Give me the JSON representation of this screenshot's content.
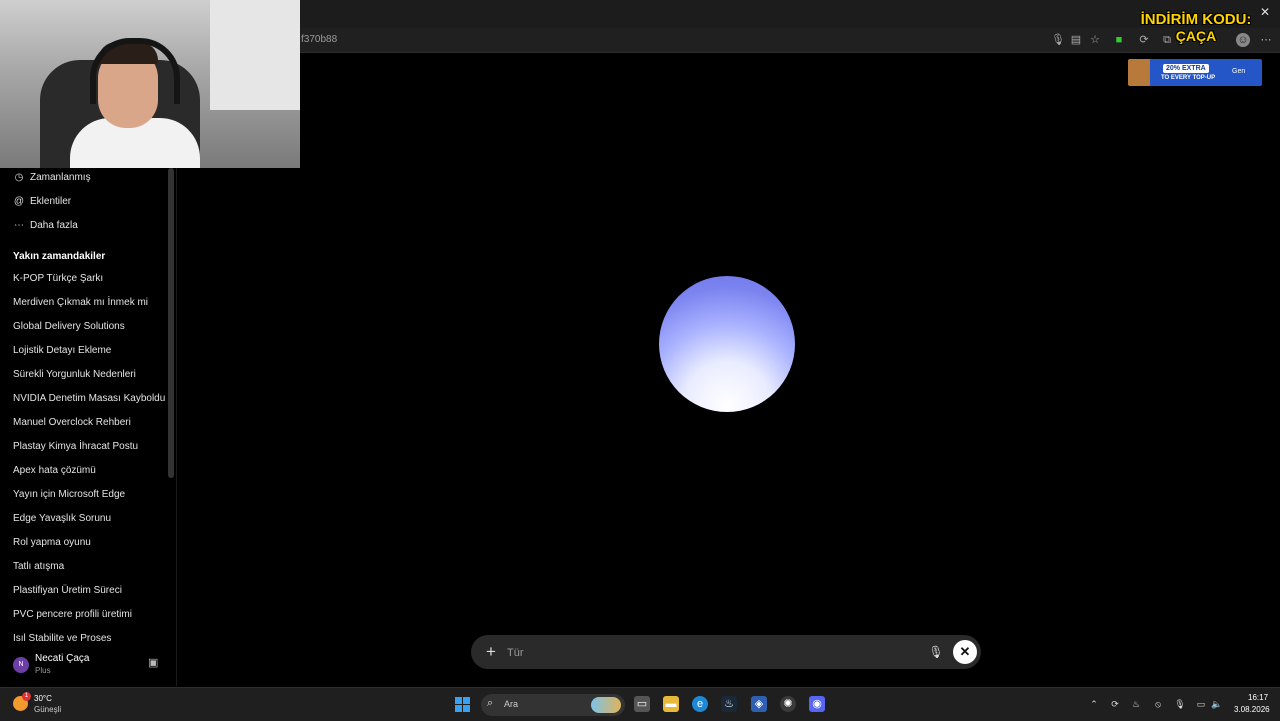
{
  "browser": {
    "url_fragment": "f370b88",
    "close_glyph": "✕"
  },
  "promo": {
    "line1": "İNDİRİM KODU:",
    "line2": "ÇAÇA",
    "banner_badge": "20% EXTRA",
    "banner_sub": "TO EVERY TOP-UP",
    "banner_brand": "Gen"
  },
  "sidebar": {
    "nav": [
      {
        "label": "Zamanlanmış",
        "icon": "clock-icon"
      },
      {
        "label": "Eklentiler",
        "icon": "at-icon"
      },
      {
        "label": "Daha fazla",
        "icon": "more-icon"
      }
    ],
    "recent_heading": "Yakın zamandakiler",
    "recent": [
      "K-POP Türkçe Şarkı",
      "Merdiven Çıkmak mı İnmek mi",
      "Global Delivery Solutions",
      "Lojistik Detayı Ekleme",
      "Sürekli Yorgunluk Nedenleri",
      "NVIDIA Denetim Masası Kayboldu",
      "Manuel Overclock Rehberi",
      "Plastay Kimya İhracat Postu",
      "Apex hata çözümü",
      "Yayın için Microsoft Edge",
      "Edge Yavaşlık Sorunu",
      "Rol yapma oyunu",
      "Tatlı atışma",
      "Plastifiyan Üretim Süreci",
      "PVC pencere profili üretimi",
      "Isıl Stabilite ve Proses"
    ],
    "user": {
      "initial": "N",
      "name": "Necati Çaça",
      "plan": "Plus"
    }
  },
  "composer": {
    "placeholder": "Tür",
    "plus_glyph": "+",
    "close_glyph": "✕"
  },
  "taskbar": {
    "weather_temp": "30°C",
    "weather_desc": "Güneşli",
    "weather_badge": "1",
    "search_label": "Ara",
    "time": "16:17",
    "date": "3.08.2026"
  },
  "colors": {
    "orb_top": "#6b74ea",
    "orb_bottom": "#ffffff",
    "background": "#000000",
    "composer_bg": "#2a2a2a"
  }
}
